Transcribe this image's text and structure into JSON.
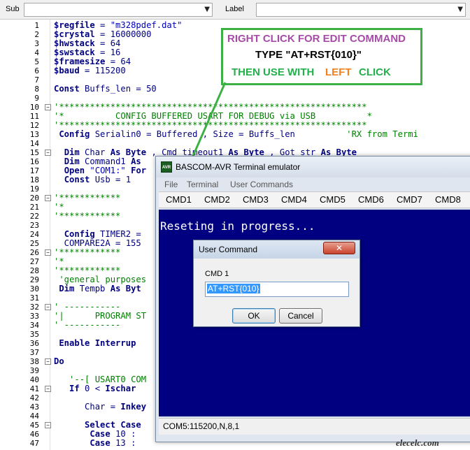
{
  "toolbar": {
    "sub_label": "Sub",
    "label_label": "Label"
  },
  "annotation": {
    "line1": "RIGHT CLICK FOR EDIT COMMAND",
    "line2": "TYPE \"AT+RST{010}\"",
    "line3a": "THEN USE WITH",
    "line3b": "LEFT",
    "line3c": "CLICK",
    "colors": {
      "line1": "#a64ca6",
      "line2": "#000000",
      "line3": "#22b04a",
      "left_word": "#f08020",
      "border": "#3cb043"
    }
  },
  "code_lines": [
    {
      "n": "1",
      "s": [
        {
          "c": "kw",
          "t": "$regfile"
        },
        {
          "c": "tx",
          "t": " = "
        },
        {
          "c": "str",
          "t": "\"m328pdef.dat\""
        }
      ]
    },
    {
      "n": "2",
      "s": [
        {
          "c": "kw",
          "t": "$crystal"
        },
        {
          "c": "tx",
          "t": " = 16000000"
        }
      ]
    },
    {
      "n": "3",
      "s": [
        {
          "c": "kw",
          "t": "$hwstack"
        },
        {
          "c": "tx",
          "t": " = 64"
        }
      ]
    },
    {
      "n": "4",
      "s": [
        {
          "c": "kw",
          "t": "$swstack"
        },
        {
          "c": "tx",
          "t": " = 16"
        }
      ]
    },
    {
      "n": "5",
      "s": [
        {
          "c": "kw",
          "t": "$framesize"
        },
        {
          "c": "tx",
          "t": " = 64"
        }
      ]
    },
    {
      "n": "6",
      "s": [
        {
          "c": "kw",
          "t": "$baud"
        },
        {
          "c": "tx",
          "t": " = 115200"
        }
      ]
    },
    {
      "n": "7",
      "s": []
    },
    {
      "n": "8",
      "s": [
        {
          "c": "kw",
          "t": "Const"
        },
        {
          "c": "tx",
          "t": " Buffs_len = 50"
        }
      ]
    },
    {
      "n": "9",
      "s": []
    },
    {
      "n": "10",
      "s": [
        {
          "c": "cm",
          "t": "'************************************************************"
        }
      ]
    },
    {
      "n": "11",
      "s": [
        {
          "c": "cm",
          "t": "'*          CONFIG BUFFERED USART FOR DEBUG via USB          *"
        }
      ]
    },
    {
      "n": "12",
      "s": [
        {
          "c": "cm",
          "t": "'************************************************************"
        }
      ]
    },
    {
      "n": "13",
      "s": [
        {
          "c": "tx",
          "t": " "
        },
        {
          "c": "kw",
          "t": "Config"
        },
        {
          "c": "tx",
          "t": " Serialin0 = Buffered , Size = Buffs_len          "
        },
        {
          "c": "cm",
          "t": "'RX from Termi"
        }
      ]
    },
    {
      "n": "14",
      "s": []
    },
    {
      "n": "15",
      "s": [
        {
          "c": "tx",
          "t": "  "
        },
        {
          "c": "kw",
          "t": "Dim"
        },
        {
          "c": "tx",
          "t": " Char "
        },
        {
          "c": "kw",
          "t": "As Byte"
        },
        {
          "c": "tx",
          "t": " , Cmd_timeout1 "
        },
        {
          "c": "kw",
          "t": "As Byte"
        },
        {
          "c": "tx",
          "t": " , Got_str "
        },
        {
          "c": "kw",
          "t": "As Byte"
        }
      ]
    },
    {
      "n": "16",
      "s": [
        {
          "c": "tx",
          "t": "  "
        },
        {
          "c": "kw",
          "t": "Dim"
        },
        {
          "c": "tx",
          "t": " Command1 "
        },
        {
          "c": "kw",
          "t": "As"
        }
      ]
    },
    {
      "n": "17",
      "s": [
        {
          "c": "tx",
          "t": "  "
        },
        {
          "c": "kw",
          "t": "Open"
        },
        {
          "c": "tx",
          "t": " "
        },
        {
          "c": "str",
          "t": "\"COM1:\""
        },
        {
          "c": "tx",
          "t": " "
        },
        {
          "c": "kw",
          "t": "For"
        }
      ]
    },
    {
      "n": "18",
      "s": [
        {
          "c": "tx",
          "t": "  "
        },
        {
          "c": "kw",
          "t": "Const"
        },
        {
          "c": "tx",
          "t": " Usb = 1"
        }
      ]
    },
    {
      "n": "19",
      "s": []
    },
    {
      "n": "20",
      "s": [
        {
          "c": "cm",
          "t": "'************"
        }
      ]
    },
    {
      "n": "21",
      "s": [
        {
          "c": "cm",
          "t": "'*"
        }
      ]
    },
    {
      "n": "22",
      "s": [
        {
          "c": "cm",
          "t": "'************"
        }
      ]
    },
    {
      "n": "23",
      "s": []
    },
    {
      "n": "24",
      "s": [
        {
          "c": "tx",
          "t": "  "
        },
        {
          "c": "kw",
          "t": "Config"
        },
        {
          "c": "tx",
          "t": " TIMER2 ="
        }
      ]
    },
    {
      "n": "25",
      "s": [
        {
          "c": "tx",
          "t": "  COMPARE2A = 155"
        }
      ]
    },
    {
      "n": "26",
      "s": [
        {
          "c": "cm",
          "t": "'************"
        }
      ]
    },
    {
      "n": "27",
      "s": [
        {
          "c": "cm",
          "t": "'*"
        }
      ]
    },
    {
      "n": "28",
      "s": [
        {
          "c": "cm",
          "t": "'************"
        }
      ]
    },
    {
      "n": "29",
      "s": [
        {
          "c": "cm",
          "t": " 'general purposes"
        }
      ]
    },
    {
      "n": "30",
      "s": [
        {
          "c": "tx",
          "t": " "
        },
        {
          "c": "kw",
          "t": "Dim"
        },
        {
          "c": "tx",
          "t": " Tempb "
        },
        {
          "c": "kw",
          "t": "As Byt"
        }
      ]
    },
    {
      "n": "31",
      "s": []
    },
    {
      "n": "32",
      "s": [
        {
          "c": "cm",
          "t": "' -----------"
        }
      ]
    },
    {
      "n": "33",
      "s": [
        {
          "c": "cm",
          "t": "'|      PROGRAM ST"
        }
      ]
    },
    {
      "n": "34",
      "s": [
        {
          "c": "cm",
          "t": "' -----------"
        }
      ]
    },
    {
      "n": "35",
      "s": []
    },
    {
      "n": "36",
      "s": [
        {
          "c": "tx",
          "t": " "
        },
        {
          "c": "kw",
          "t": "Enable Interrup"
        }
      ]
    },
    {
      "n": "37",
      "s": []
    },
    {
      "n": "38",
      "s": [
        {
          "c": "kw",
          "t": "Do"
        }
      ]
    },
    {
      "n": "39",
      "s": []
    },
    {
      "n": "40",
      "s": [
        {
          "c": "tx",
          "t": "   "
        },
        {
          "c": "cm",
          "t": "'--[ USART0 COM"
        }
      ]
    },
    {
      "n": "41",
      "s": [
        {
          "c": "tx",
          "t": "   "
        },
        {
          "c": "kw",
          "t": "If"
        },
        {
          "c": "tx",
          "t": " 0 < "
        },
        {
          "c": "kw",
          "t": "Ischar"
        }
      ]
    },
    {
      "n": "42",
      "s": []
    },
    {
      "n": "43",
      "s": [
        {
          "c": "tx",
          "t": "      Char = "
        },
        {
          "c": "kw",
          "t": "Inkey"
        }
      ]
    },
    {
      "n": "44",
      "s": []
    },
    {
      "n": "45",
      "s": [
        {
          "c": "tx",
          "t": "      "
        },
        {
          "c": "kw",
          "t": "Select Case"
        }
      ]
    },
    {
      "n": "46",
      "s": [
        {
          "c": "tx",
          "t": "       "
        },
        {
          "c": "kw",
          "t": "Case"
        },
        {
          "c": "tx",
          "t": " 10 :"
        }
      ]
    },
    {
      "n": "47",
      "s": [
        {
          "c": "tx",
          "t": "       "
        },
        {
          "c": "kw",
          "t": "Case"
        },
        {
          "c": "tx",
          "t": " 13 :"
        }
      ]
    }
  ],
  "terminal": {
    "title": "BASCOM-AVR Terminal emulator",
    "app_icon": "AVR",
    "menu": [
      "File",
      "Terminal",
      "User Commands"
    ],
    "commands": [
      "CMD1",
      "CMD2",
      "CMD3",
      "CMD4",
      "CMD5",
      "CMD6",
      "CMD7",
      "CMD8"
    ],
    "output": "Reseting in progress...",
    "status": "COM5:115200,N,8,1",
    "screen_color": "#000080"
  },
  "dialog": {
    "title": "User Command",
    "close_icon": "close-icon",
    "label": "CMD 1",
    "input_value": "AT+RST{010}",
    "ok_label": "OK",
    "cancel_label": "Cancel"
  },
  "watermark": "elecelc.com"
}
